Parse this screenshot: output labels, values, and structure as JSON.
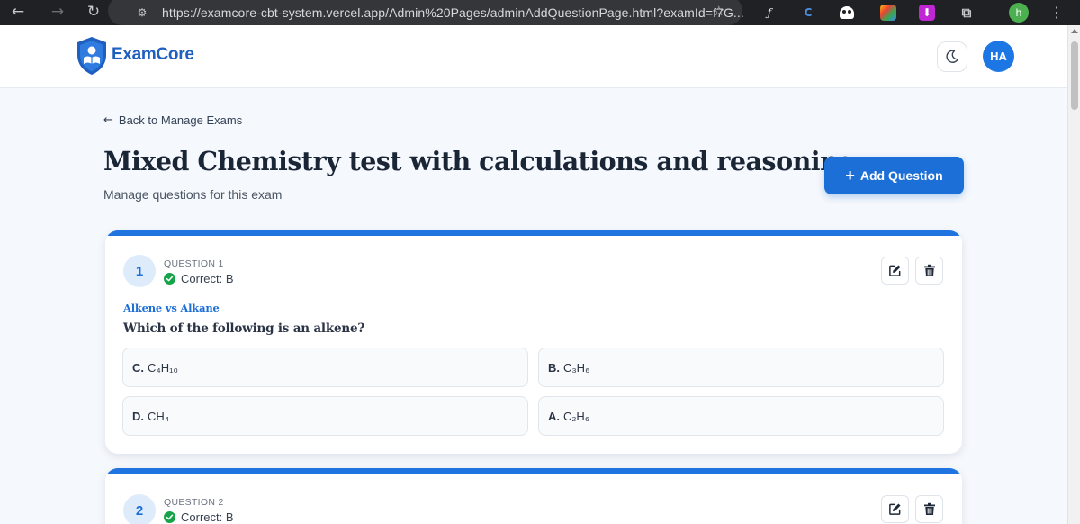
{
  "browser": {
    "url": "https://examcore-cbt-system.vercel.app/Admin%20Pages/adminAddQuestionPage.html?examId=f7G...",
    "profile_initial": "h",
    "icons": [
      "back-icon",
      "forward-icon",
      "reload-icon",
      "site-info-icon",
      "star-icon",
      "extension-fx-icon",
      "extension-c-icon",
      "extension-ghost-icon",
      "extension-rainbow-icon",
      "extension-download-icon",
      "extensions-puzzle-icon",
      "menu-icon"
    ]
  },
  "header": {
    "brand": "ExamCore",
    "avatar_initials": "HA",
    "brand_color": "#1e5fbf",
    "accent_color": "#1d6fd8"
  },
  "main": {
    "back_label": "Back to Manage Exams",
    "title": "Mixed Chemistry test with calculations and reasoning",
    "subtitle": "Manage questions for this exam",
    "add_button_label": "Add Question"
  },
  "questions": [
    {
      "number": "1",
      "label": "QUESTION 1",
      "correct": "Correct: B",
      "topic": "Alkene vs Alkane",
      "text": "Which of the following is an alkene?",
      "options": [
        {
          "letter": "C.",
          "value": "C₄H₁₀"
        },
        {
          "letter": "B.",
          "value": "C₃H₆"
        },
        {
          "letter": "D.",
          "value": "CH₄"
        },
        {
          "letter": "A.",
          "value": "C₂H₆"
        }
      ]
    },
    {
      "number": "2",
      "label": "QUESTION 2",
      "correct": "Correct: B"
    }
  ],
  "colors": {
    "correct_green": "#16a34a",
    "card_accent": "#1f74e0"
  }
}
